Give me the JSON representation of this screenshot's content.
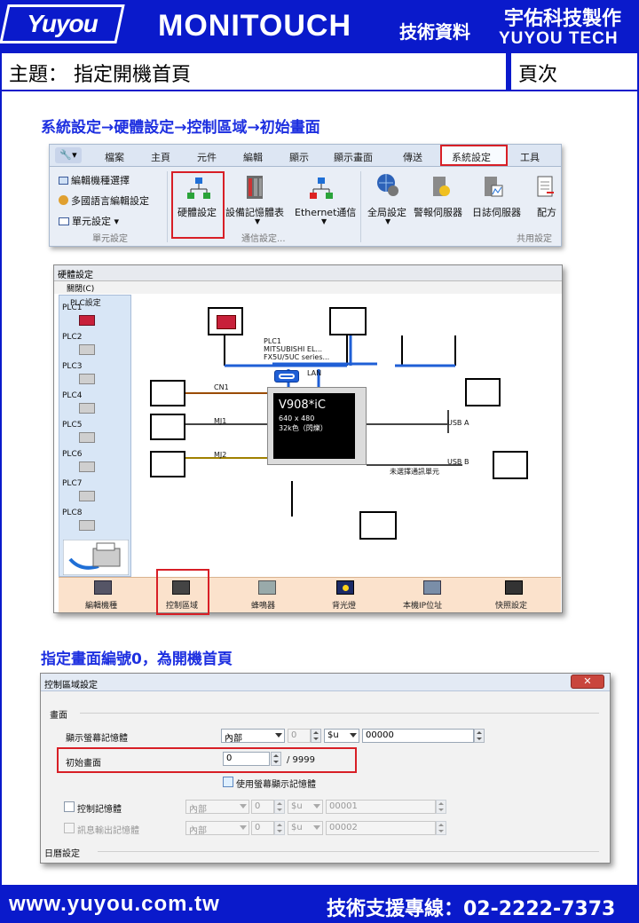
{
  "header": {
    "logo": "Yuyou",
    "brand": "MONITOUCH",
    "doc_type": "技術資料",
    "company_cn": "宇佑科技製作",
    "company_en": "YUYOU TECH"
  },
  "title_row": {
    "subject": "主題：  指定開機首頁",
    "page_label": "頁次"
  },
  "section1": {
    "title": "系統設定→硬體設定→控制區域→初始畫面"
  },
  "ribbon": {
    "orb": "🔧▾",
    "tabs": [
      "檔案",
      "主頁",
      "元件",
      "編輯",
      "顯示",
      "顯示畫面",
      "傳送",
      "系統設定",
      "工具"
    ],
    "left_items": [
      "編輯機種選擇",
      "多國語言編輯設定",
      "單元設定 ▾"
    ],
    "buttons": [
      "硬體設定",
      "設備記憶體表",
      "Ethernet通信",
      "全局設定",
      "警報伺服器",
      "日誌伺服器",
      "配方"
    ],
    "groups": [
      "單元設定",
      "通信設定...",
      "共用設定"
    ]
  },
  "hw_window": {
    "title": "硬體設定",
    "menu": "關閉(C)",
    "plc_setting": "PLC設定",
    "plcs": [
      "PLC1",
      "PLC2",
      "PLC3",
      "PLC4",
      "PLC5",
      "PLC6",
      "PLC7",
      "PLC8"
    ],
    "diagram": {
      "plc1_lines": [
        "PLC1",
        "MITSUBISHI EL...",
        "FX5U/5UC series..."
      ],
      "lan": "LAN",
      "ports": [
        "CN1",
        "MJ1",
        "MJ2"
      ],
      "usb": [
        "USB A",
        "USB B"
      ],
      "model": "V908*iC",
      "resolution": "640 x 480",
      "colors": "32k色（閃爍）",
      "comm_unit": "未選擇通訊單元"
    },
    "bar": [
      "編輯機種",
      "控制區域",
      "蜂鳴器",
      "背光燈",
      "本機IP位址",
      "快照設定"
    ]
  },
  "section2": {
    "title": "指定畫面編號0，為開機首頁"
  },
  "dialog": {
    "title": "控制區域設定",
    "close": "✕",
    "sec_screen": "畫面",
    "row_display": {
      "label": "顯示螢幕記憶體",
      "type": "內部",
      "num": "0",
      "sym": "$u",
      "addr": "00000"
    },
    "row_initial": {
      "label": "初始畫面",
      "value": "0",
      "max": "/ 9999"
    },
    "use_display_mem": "使用螢幕顯示記憶體",
    "row_control": {
      "label": "控制記憶體",
      "type": "內部",
      "num": "0",
      "sym": "$u",
      "addr": "00001"
    },
    "row_info": {
      "label": "訊息輸出記憶體",
      "type": "內部",
      "num": "0",
      "sym": "$u",
      "addr": "00002"
    },
    "sec_calendar": "日曆設定"
  },
  "footer": {
    "url": "www.yuyou.com.tw",
    "hotline": "技術支援專線：02-2222-7373"
  },
  "colors": {
    "brand_blue": "#0a1acb",
    "highlight_red": "#d81f26",
    "section_blue": "#1d2fe0"
  }
}
